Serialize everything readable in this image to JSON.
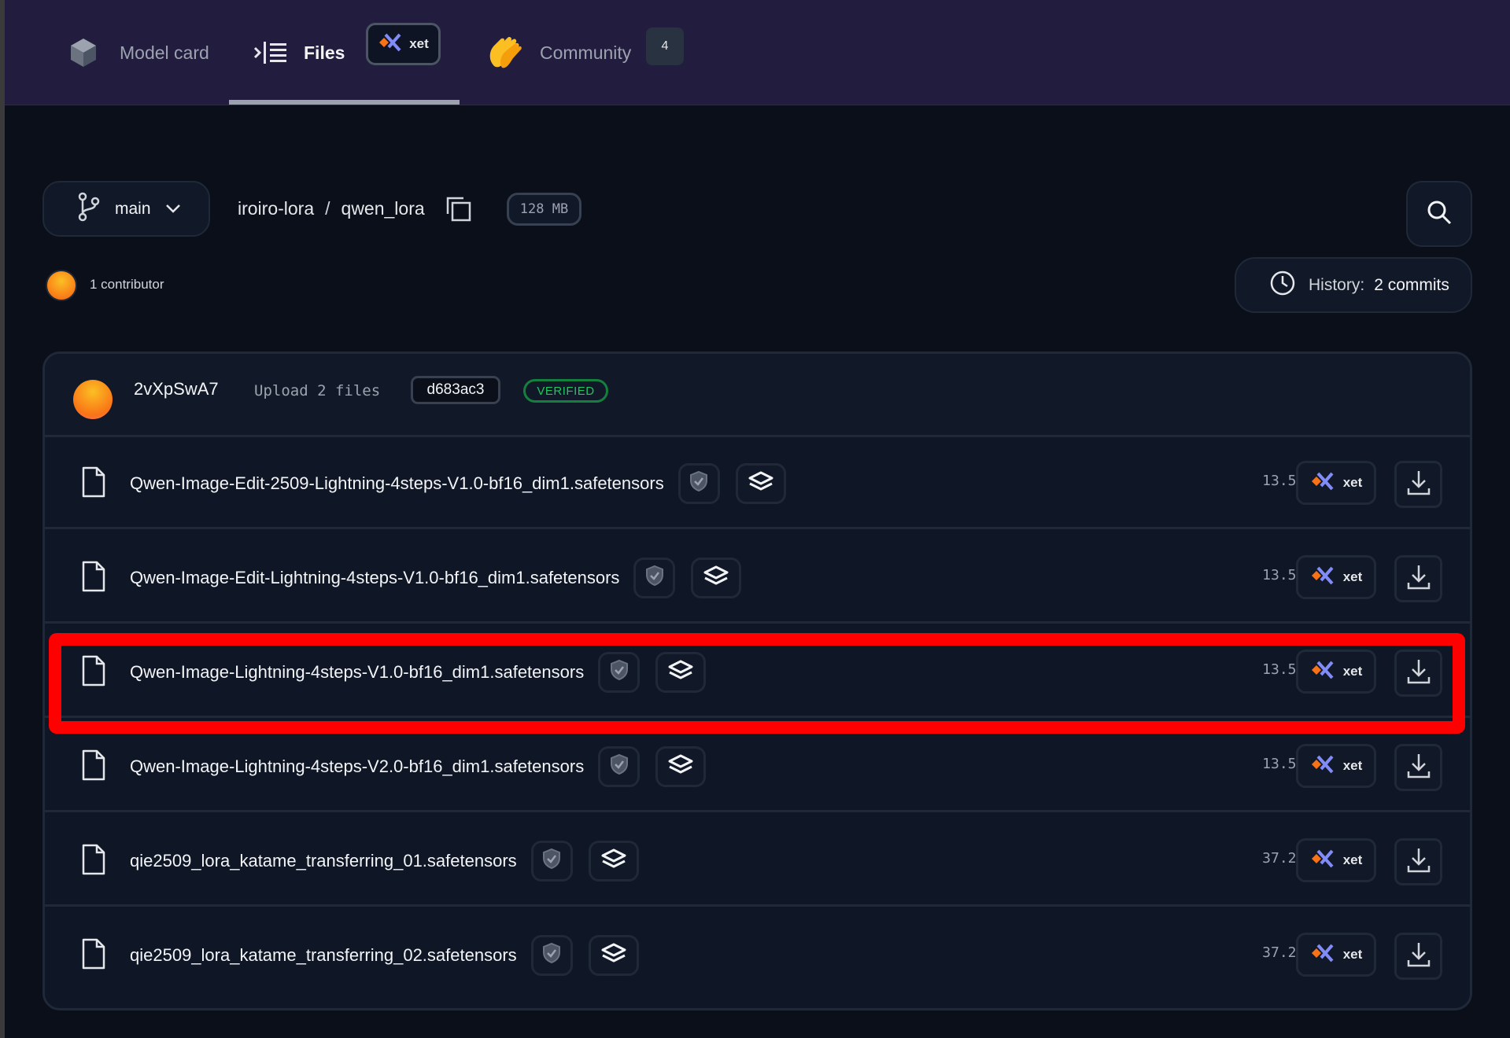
{
  "header": {
    "tabs": [
      {
        "label": "Model card",
        "icon": "cube-icon"
      },
      {
        "label": "Files",
        "icon": "files-icon",
        "active": true
      },
      {
        "label": "Community",
        "icon": "clap-hands-icon",
        "count": "4"
      }
    ],
    "xet_label": "xet"
  },
  "repo": {
    "branch": "main",
    "owner": "iroiro-lora",
    "separator": "/",
    "name": "qwen_lora",
    "size": "128 MB",
    "contributors": "1 contributor",
    "history_label": "History:",
    "history_count": "2 commits"
  },
  "commit": {
    "user": "2vXpSwA7",
    "message": "Upload 2 files",
    "hash": "d683ac3",
    "status": "VERIFIED"
  },
  "files": [
    {
      "name": "Qwen-Image-Edit-2509-Lightning-4steps-V1.0-bf16_dim1.safetensors",
      "size": "13.5 MB",
      "xet": "xet"
    },
    {
      "name": "Qwen-Image-Edit-Lightning-4steps-V1.0-bf16_dim1.safetensors",
      "size": "13.5 MB",
      "xet": "xet"
    },
    {
      "name": "Qwen-Image-Lightning-4steps-V1.0-bf16_dim1.safetensors",
      "size": "13.5 MB",
      "xet": "xet",
      "highlighted": true
    },
    {
      "name": "Qwen-Image-Lightning-4steps-V2.0-bf16_dim1.safetensors",
      "size": "13.5 MB",
      "xet": "xet"
    },
    {
      "name": "qie2509_lora_katame_transferring_01.safetensors",
      "size": "37.2 MB",
      "xet": "xet"
    },
    {
      "name": "qie2509_lora_katame_transferring_02.safetensors",
      "size": "37.2 MB",
      "xet": "xet"
    }
  ],
  "colors": {
    "header_bg": "#221c3f",
    "page_bg": "#0b0f19",
    "highlight": "#ff0000",
    "verified": "#22c55e",
    "xet_orange": "#f97316",
    "xet_purple": "#818cf8"
  }
}
